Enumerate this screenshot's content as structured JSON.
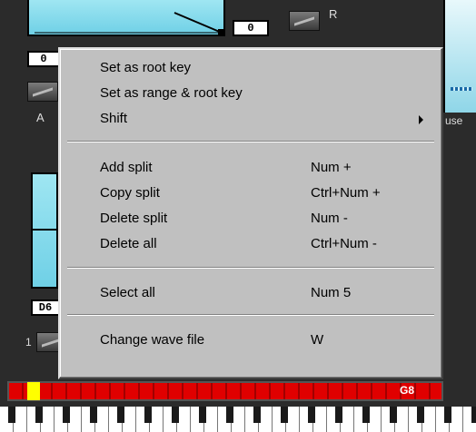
{
  "background": {
    "top_value": "0",
    "left_value": "0",
    "r_label": "R",
    "a_label": "A",
    "use_label": "use",
    "d_field": "D6",
    "one_label": "1",
    "keyboard_label": "G8"
  },
  "menu": {
    "items": [
      {
        "label": "Set as root key",
        "shortcut": ""
      },
      {
        "label": "Set as range & root key",
        "shortcut": ""
      },
      {
        "label": "Shift",
        "shortcut": ""
      },
      {
        "label": "Add split",
        "shortcut": "Num +"
      },
      {
        "label": "Copy split",
        "shortcut": "Ctrl+Num +"
      },
      {
        "label": "Delete split",
        "shortcut": "Num -"
      },
      {
        "label": "Delete all",
        "shortcut": "Ctrl+Num -"
      },
      {
        "label": "Select all",
        "shortcut": "Num 5"
      },
      {
        "label": "Change wave file",
        "shortcut": "W"
      }
    ]
  }
}
